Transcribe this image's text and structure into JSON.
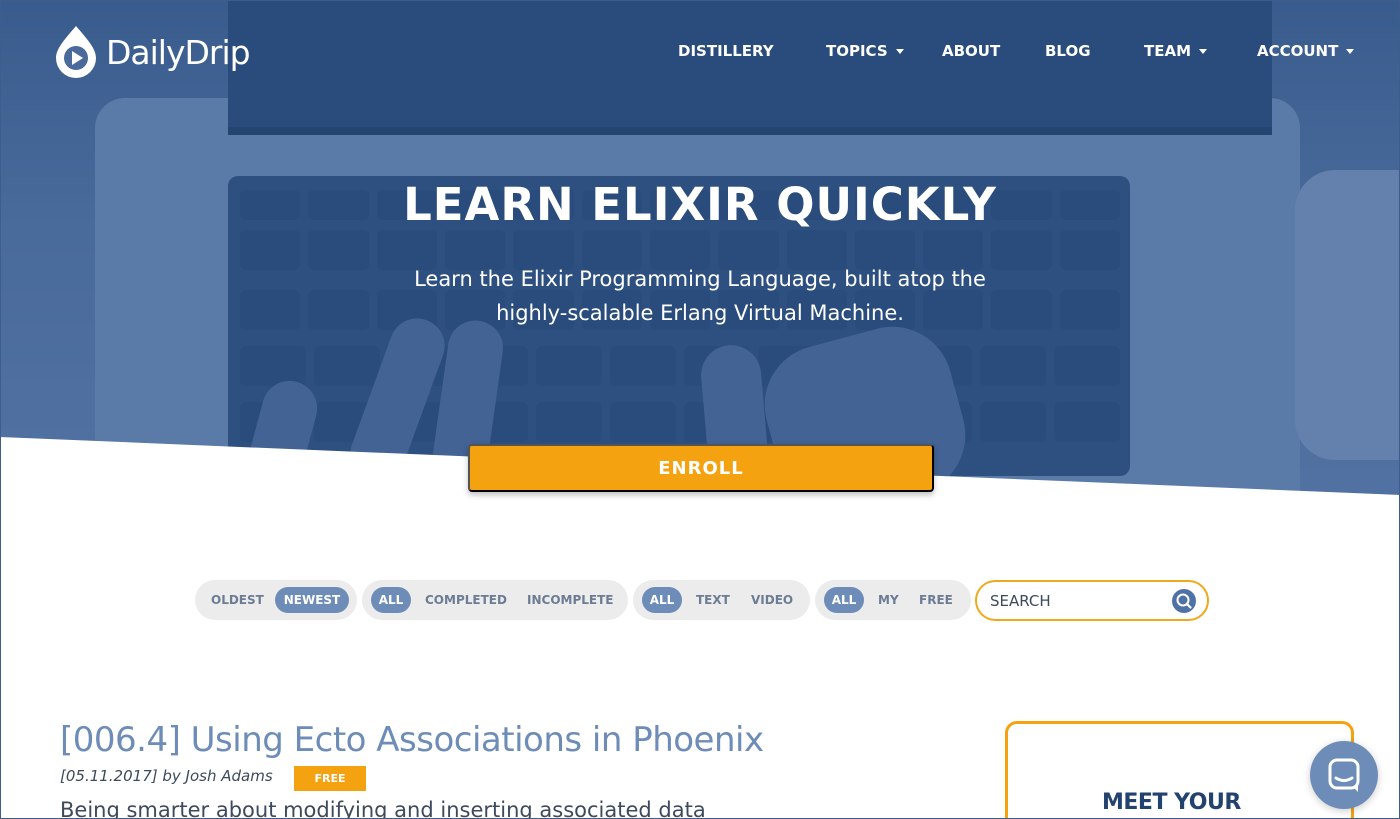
{
  "brand": {
    "name": "DailyDrip",
    "logo_icon": "droplet-play-icon"
  },
  "nav": {
    "items": [
      {
        "label": "DISTILLERY",
        "has_dropdown": false
      },
      {
        "label": "TOPICS",
        "has_dropdown": true
      },
      {
        "label": "ABOUT",
        "has_dropdown": false
      },
      {
        "label": "BLOG",
        "has_dropdown": false
      },
      {
        "label": "TEAM",
        "has_dropdown": true
      },
      {
        "label": "ACCOUNT",
        "has_dropdown": true
      }
    ]
  },
  "hero": {
    "title": "LEARN ELIXIR QUICKLY",
    "subtitle_line1": "Learn the Elixir Programming Language, built atop the",
    "subtitle_line2": "highly-scalable Erlang Virtual Machine.",
    "cta_label": "ENROLL"
  },
  "filters": {
    "sort": {
      "options": [
        "OLDEST",
        "NEWEST"
      ],
      "selected": "NEWEST"
    },
    "completion": {
      "options": [
        "ALL",
        "COMPLETED",
        "INCOMPLETE"
      ],
      "selected": "ALL"
    },
    "format": {
      "options": [
        "ALL",
        "TEXT",
        "VIDEO"
      ],
      "selected": "ALL"
    },
    "access": {
      "options": [
        "ALL",
        "MY",
        "FREE"
      ],
      "selected": "ALL"
    },
    "search": {
      "placeholder": "SEARCH",
      "value": ""
    }
  },
  "article": {
    "title": "[006.4] Using Ecto Associations in Phoenix",
    "date": "[05.11.2017]",
    "byline": "by Josh Adams",
    "badge": "FREE",
    "excerpt": "Being smarter about modifying and inserting associated data"
  },
  "sidebar_card": {
    "title": "MEET YOUR"
  },
  "chat": {
    "icon": "chat-icon"
  },
  "colors": {
    "accent": "#f5a211",
    "brand_blue": "#6d8cb8",
    "dark_navy": "#23426f",
    "text": "#3c4a5c"
  }
}
